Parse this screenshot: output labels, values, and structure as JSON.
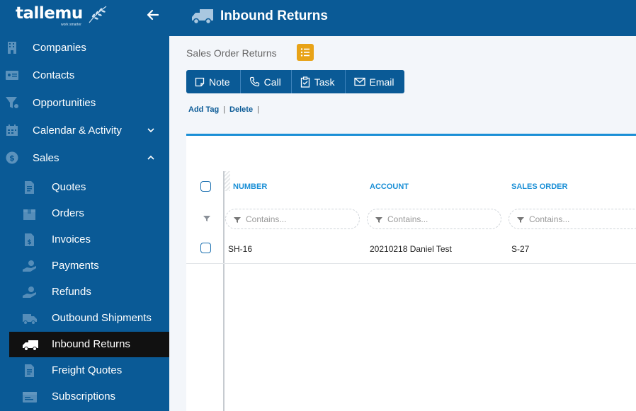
{
  "brand": {
    "wordmark": "tallemu",
    "tagline": "work smarter"
  },
  "sidebar": {
    "items": [
      {
        "label": "Companies",
        "icon": "building-icon"
      },
      {
        "label": "Contacts",
        "icon": "contact-card-icon"
      },
      {
        "label": "Opportunities",
        "icon": "funnel-icon"
      },
      {
        "label": "Calendar & Activity",
        "icon": "calendar-icon",
        "expander": "chevron-down"
      },
      {
        "label": "Sales",
        "icon": "dollar-icon",
        "expander": "chevron-up"
      }
    ],
    "sales_sub": [
      {
        "label": "Quotes",
        "icon": "document-icon"
      },
      {
        "label": "Orders",
        "icon": "box-icon"
      },
      {
        "label": "Invoices",
        "icon": "invoice-icon"
      },
      {
        "label": "Payments",
        "icon": "hand-coin-icon"
      },
      {
        "label": "Refunds",
        "icon": "hand-coin-icon"
      },
      {
        "label": "Outbound Shipments",
        "icon": "truck-icon"
      },
      {
        "label": "Inbound Returns",
        "icon": "truck-icon",
        "active": true
      },
      {
        "label": "Freight Quotes",
        "icon": "document-icon"
      },
      {
        "label": "Subscriptions",
        "icon": "subscription-icon"
      }
    ]
  },
  "header": {
    "title": "Inbound Returns",
    "icon": "truck-icon"
  },
  "main": {
    "subtitle": "Sales Order Returns",
    "actions": [
      {
        "label": "Note",
        "icon": "note-icon"
      },
      {
        "label": "Call",
        "icon": "phone-icon"
      },
      {
        "label": "Task",
        "icon": "clipboard-check-icon"
      },
      {
        "label": "Email",
        "icon": "envelope-icon"
      }
    ],
    "links": {
      "add_tag": "Add Tag",
      "delete": "Delete"
    }
  },
  "grid": {
    "columns": [
      "NUMBER",
      "ACCOUNT",
      "SALES ORDER"
    ],
    "filter_placeholder": "Contains...",
    "rows": [
      {
        "number": "SH-16",
        "account": "20210218 Daniel Test",
        "sales_order": "S-27"
      }
    ]
  },
  "colors": {
    "primary": "#0a5a96",
    "accent": "#1a8fd6",
    "list_button": "#e8a317",
    "active_nav": "#111111"
  }
}
